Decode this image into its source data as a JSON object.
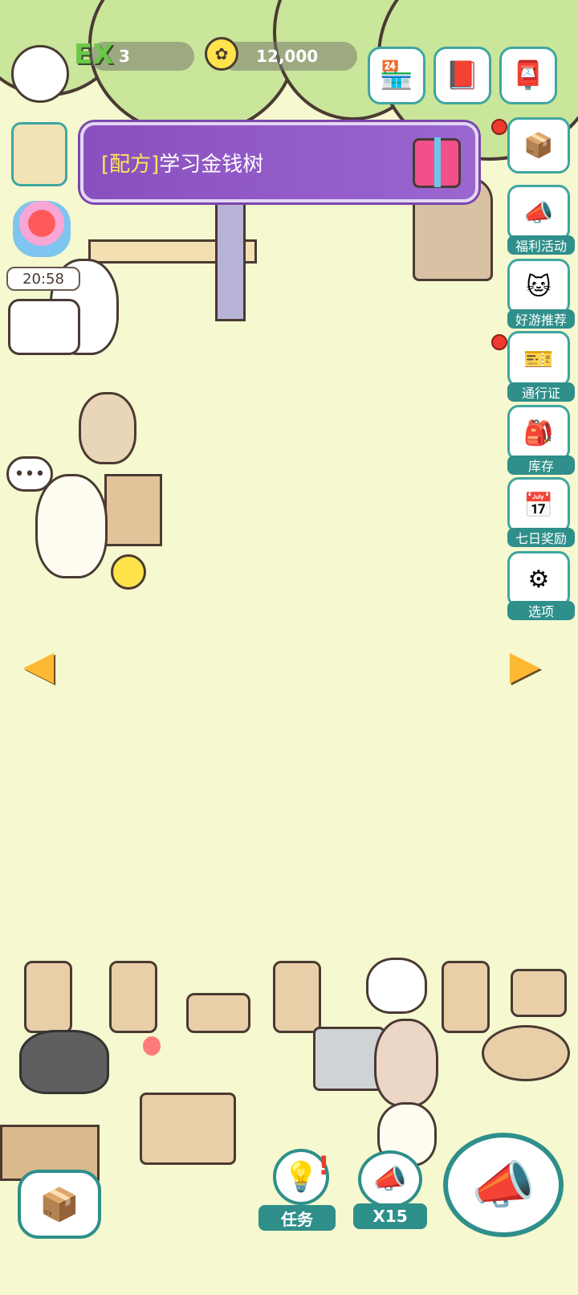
{
  "header": {
    "ex_label": "EX",
    "level": "3",
    "coins": "12,000"
  },
  "top_buttons": [
    {
      "name": "shop",
      "icon": "shop-icon"
    },
    {
      "name": "collection-book",
      "icon": "book-icon"
    },
    {
      "name": "mailbox",
      "icon": "mailbox-icon"
    }
  ],
  "banner": {
    "tag": "[配方]",
    "text": "学习金钱树",
    "icon": "gift-icon"
  },
  "left": {
    "timer": "20:58",
    "speech": "•••"
  },
  "side_menu": [
    {
      "label": "",
      "icon": "cat-box-icon"
    },
    {
      "label": "福利活动",
      "icon": "cat-megaphone-icon"
    },
    {
      "label": "好游推荐",
      "icon": "cat-box-icon"
    },
    {
      "label": "通行证",
      "icon": "pass-ticket-icon"
    },
    {
      "label": "库存",
      "icon": "backpack-icon"
    },
    {
      "label": "七日奖励",
      "icon": "calendar-icon"
    },
    {
      "label": "选项",
      "icon": "gear-icon"
    }
  ],
  "bottom": {
    "quest_label": "任务",
    "multiplier_label": "X15"
  },
  "colors": {
    "background": "#f6f8cf",
    "teal": "#2f8f8a",
    "banner_purple": "#8a4fbf",
    "tag_yellow": "#ffe65a"
  }
}
